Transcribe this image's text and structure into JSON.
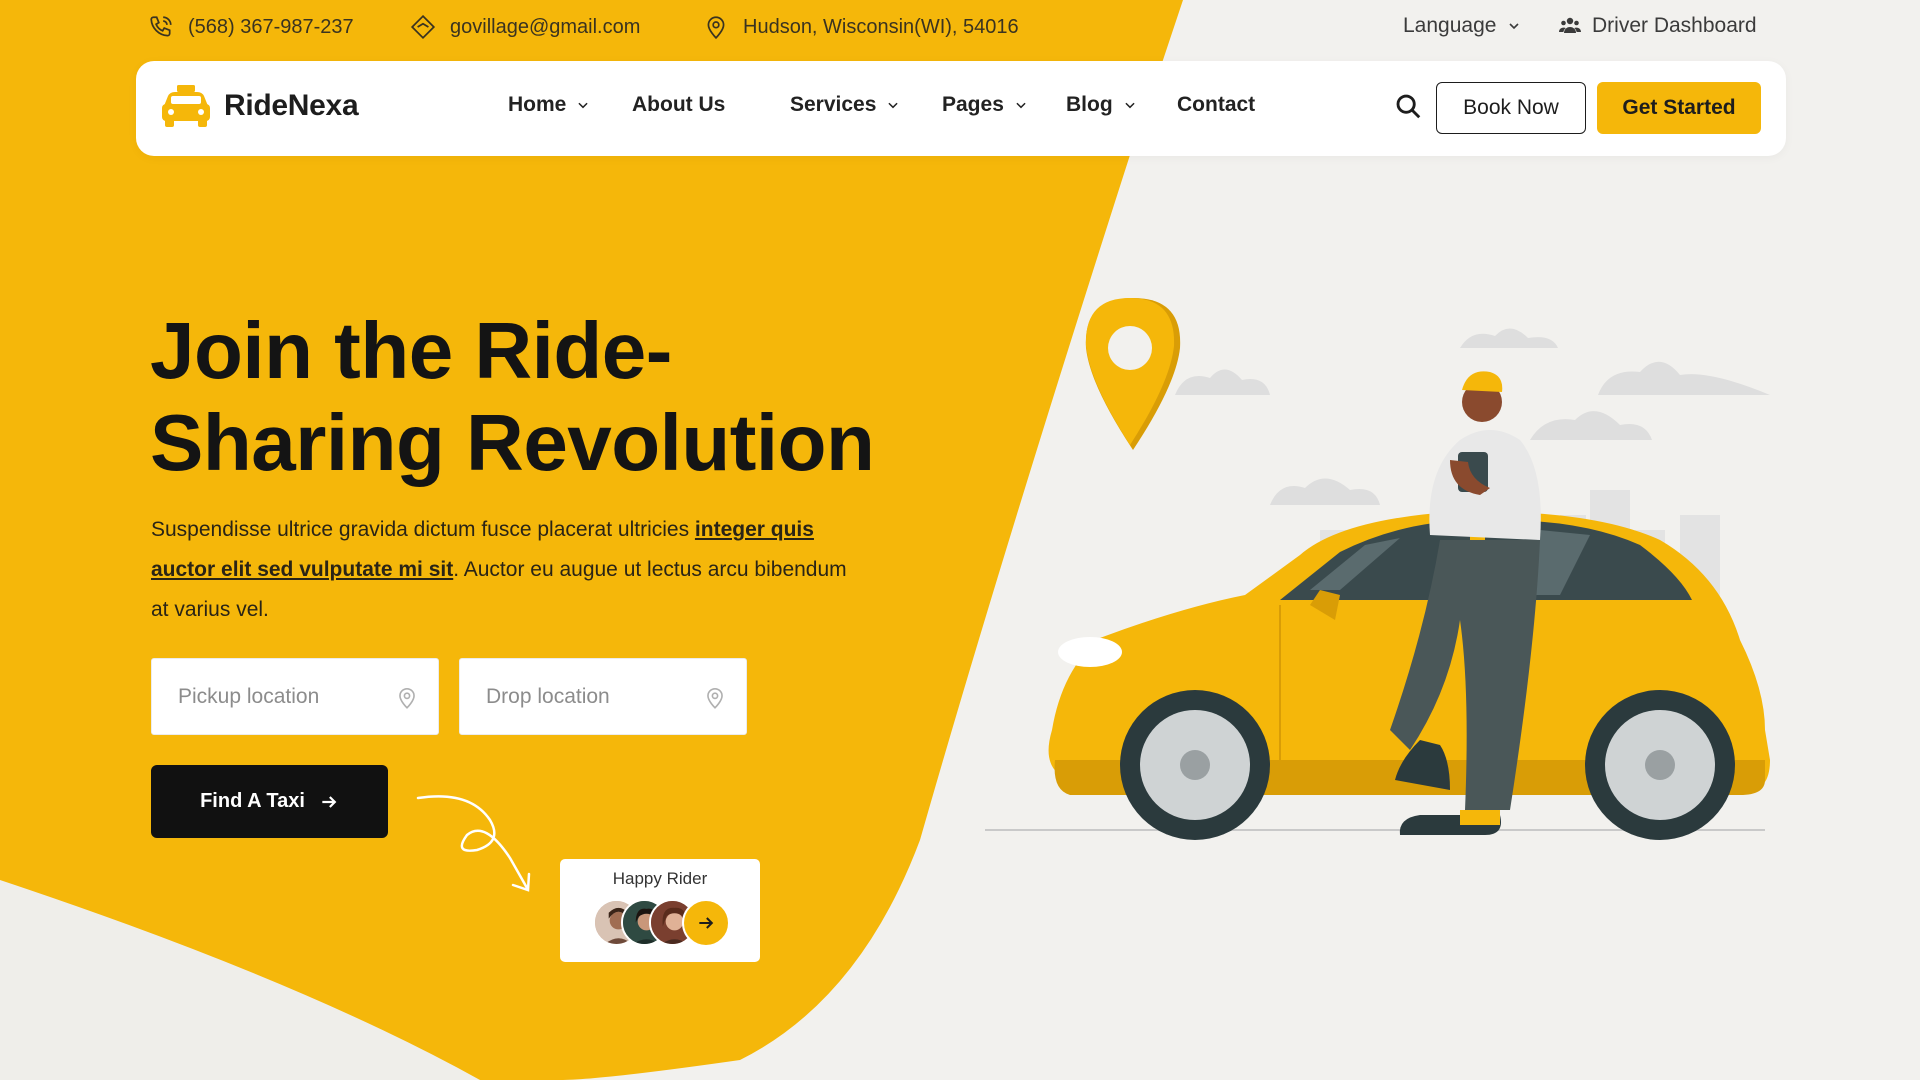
{
  "topbar": {
    "phone": "(568) 367-987-237",
    "email": "govillage@gmail.com",
    "address": "Hudson, Wisconsin(WI), 54016",
    "language": "Language",
    "driver_dashboard": "Driver Dashboard"
  },
  "brand": {
    "name": "RideNexa"
  },
  "nav": {
    "items": [
      {
        "label": "Home",
        "dropdown": true
      },
      {
        "label": "About Us",
        "dropdown": false
      },
      {
        "label": "Services",
        "dropdown": true
      },
      {
        "label": "Pages",
        "dropdown": true
      },
      {
        "label": "Blog",
        "dropdown": true
      },
      {
        "label": "Contact",
        "dropdown": false
      }
    ],
    "book_now": "Book Now",
    "get_started": "Get Started"
  },
  "hero": {
    "title_line1": "Join the Ride-",
    "title_line2": "Sharing Revolution",
    "desc_part1": "Suspendisse ultrice gravida dictum fusce placerat ultricies ",
    "desc_emphasis": "integer quis auctor elit sed vulputate mi sit",
    "desc_part2": ". Auctor eu augue ut lectus arcu bibendum at varius vel."
  },
  "search": {
    "pickup_placeholder": "Pickup location",
    "drop_placeholder": "Drop location",
    "find_button": "Find A Taxi"
  },
  "happy_rider": {
    "label": "Happy Rider"
  },
  "icons": {
    "phone": "phone-icon",
    "email": "email-icon",
    "address": "map-pin-icon",
    "language": "chevron-down-icon",
    "driver_dashboard": "users-icon",
    "search": "search-icon",
    "location": "location-pin-icon",
    "arrow": "arrow-right-icon"
  },
  "colors": {
    "accent": "#f5b70a",
    "dark": "#111111",
    "background": "#f2f1ee",
    "white": "#ffffff"
  }
}
